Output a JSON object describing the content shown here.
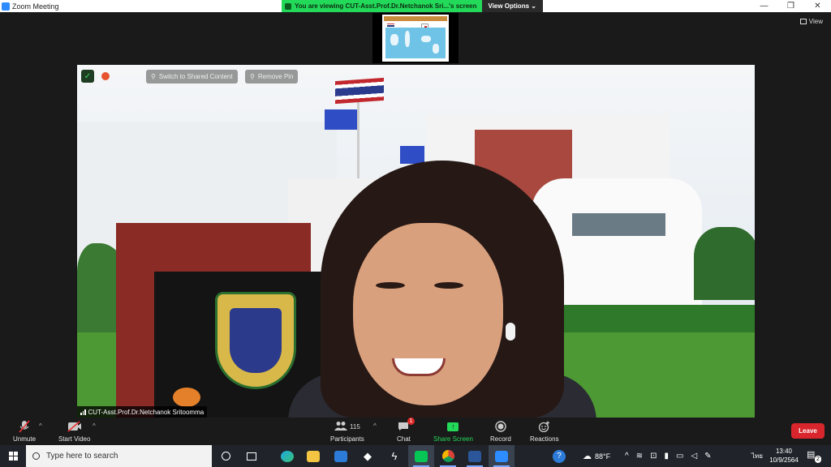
{
  "window": {
    "title": "Zoom Meeting",
    "minimize": "—",
    "maximize": "❐",
    "close": "✕"
  },
  "share_banner": {
    "text": "You are viewing CUT-Asst.Prof.Dr.Netchanok Sri...'s screen",
    "view_options": "View Options ⌄"
  },
  "view_button": {
    "label": "View"
  },
  "shared_slide": {
    "labels": [
      "Thailand",
      "Japan"
    ]
  },
  "video_overlay": {
    "switch_label": "Switch to Shared Content",
    "remove_pin_label": "Remove Pin",
    "participant_name": "CUT-Asst.Prof.Dr.Netchanok Sritoomma"
  },
  "toolbar": {
    "unmute": "Unmute",
    "start_video": "Start Video",
    "participants": "Participants",
    "participants_count": "115",
    "chat": "Chat",
    "chat_badge": "1",
    "share_screen": "Share Screen",
    "record": "Record",
    "reactions": "Reactions",
    "leave": "Leave"
  },
  "taskbar": {
    "search_placeholder": "Type here to search",
    "weather": "88°F",
    "language": "ไทย",
    "time": "13:40",
    "date": "10/9/2564",
    "notifications_count": "2"
  },
  "colors": {
    "zoom_blue": "#2d8cff",
    "share_green": "#23d959",
    "leave_red": "#d9262c"
  },
  "icons": [
    "microphone-muted-icon",
    "video-off-icon",
    "participants-icon",
    "chat-icon",
    "share-screen-icon",
    "record-icon",
    "reactions-icon",
    "windows-start-icon",
    "search-icon",
    "task-view-icon",
    "edge-icon",
    "file-explorer-icon",
    "mail-icon",
    "dropbox-icon",
    "line-icon",
    "chrome-icon",
    "word-icon",
    "zoom-icon",
    "help-icon",
    "weather-icon",
    "wifi-icon",
    "volume-icon",
    "battery-icon"
  ]
}
